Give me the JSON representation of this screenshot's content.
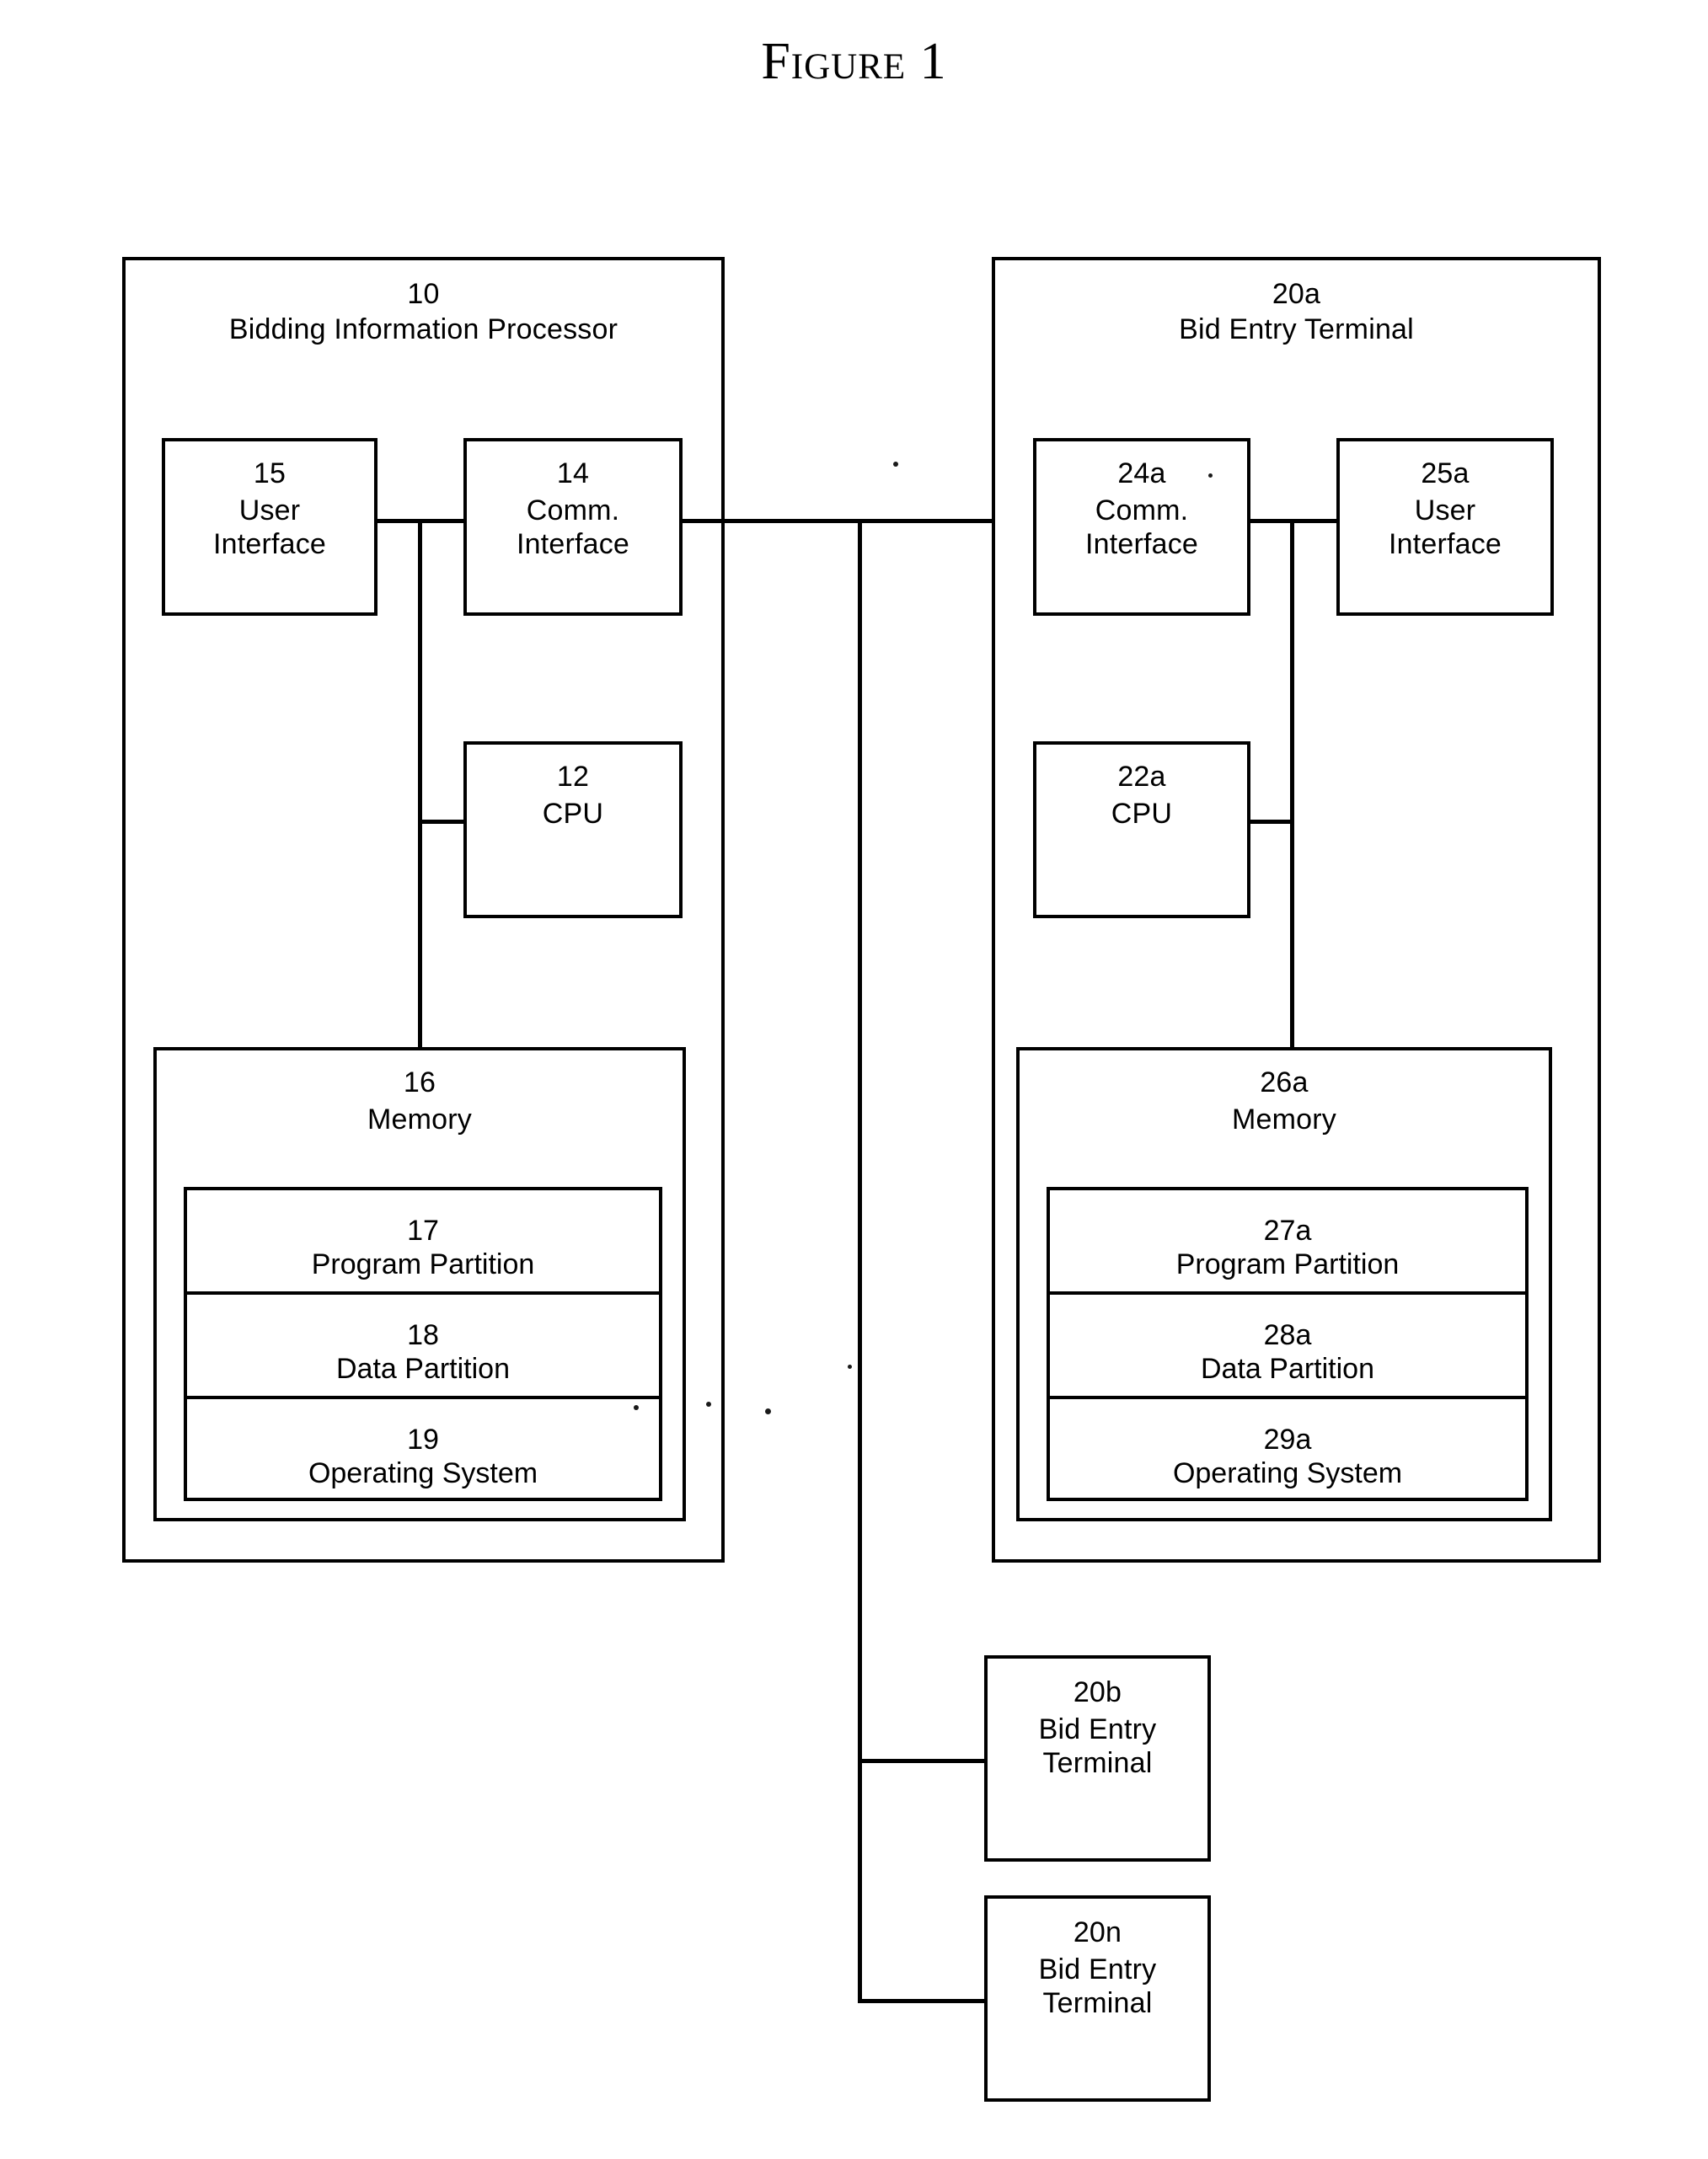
{
  "title": "Figure 1",
  "processor": {
    "ref": "10",
    "name": "Bidding Information Processor",
    "user_interface": {
      "ref": "15",
      "name": "User\nInterface"
    },
    "comm_interface": {
      "ref": "14",
      "name": "Comm.\nInterface"
    },
    "cpu": {
      "ref": "12",
      "name": "CPU"
    },
    "memory": {
      "ref": "16",
      "name": "Memory",
      "partitions": [
        {
          "ref": "17",
          "name": "Program Partition"
        },
        {
          "ref": "18",
          "name": "Data Partition"
        },
        {
          "ref": "19",
          "name": "Operating System"
        }
      ]
    }
  },
  "terminal_a": {
    "ref": "20a",
    "name": "Bid Entry Terminal",
    "comm_interface": {
      "ref": "24a",
      "name": "Comm.\nInterface"
    },
    "user_interface": {
      "ref": "25a",
      "name": "User\nInterface"
    },
    "cpu": {
      "ref": "22a",
      "name": "CPU"
    },
    "memory": {
      "ref": "26a",
      "name": "Memory",
      "partitions": [
        {
          "ref": "27a",
          "name": "Program Partition"
        },
        {
          "ref": "28a",
          "name": "Data Partition"
        },
        {
          "ref": "29a",
          "name": "Operating System"
        }
      ]
    }
  },
  "terminal_b": {
    "ref": "20b",
    "name": "Bid Entry\nTerminal"
  },
  "terminal_n": {
    "ref": "20n",
    "name": "Bid Entry\nTerminal"
  },
  "colors": {
    "ink": "#000000",
    "paper": "#ffffff"
  }
}
